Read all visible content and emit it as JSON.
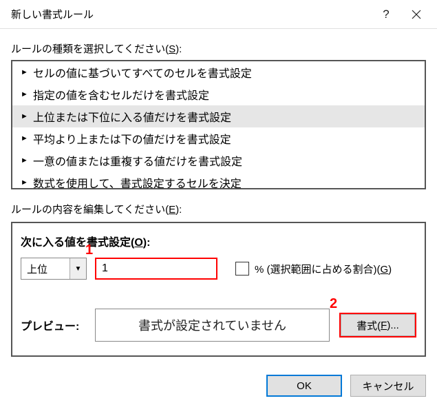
{
  "title": "新しい書式ルール",
  "sectionSelectLabel": "ルールの種類を選択してください(",
  "sectionSelectAccel": "S",
  "sectionSelectClose": "):",
  "rules": [
    "セルの値に基づいてすべてのセルを書式設定",
    "指定の値を含むセルだけを書式設定",
    "上位または下位に入る値だけを書式設定",
    "平均より上または下の値だけを書式設定",
    "一意の値または重複する値だけを書式設定",
    "数式を使用して、書式設定するセルを決定"
  ],
  "sectionEditLabel": "ルールの内容を編集してください(",
  "sectionEditAccel": "E",
  "sectionEditClose": "):",
  "rankLabel": "次に入る値を書式設定(",
  "rankAccel": "O",
  "rankClose": "):",
  "comboValue": "上位",
  "rankValue": "1",
  "percentLabel": "% (選択範囲に占める割合)(",
  "percentAccel": "G",
  "percentClose": ")",
  "previewLabel": "プレビュー:",
  "previewText": "書式が設定されていません",
  "formatBtnPre": "書式(",
  "formatBtnAccel": "F",
  "formatBtnPost": ")...",
  "ok": "OK",
  "cancel": "キャンセル",
  "marker1": "1",
  "marker2": "2"
}
